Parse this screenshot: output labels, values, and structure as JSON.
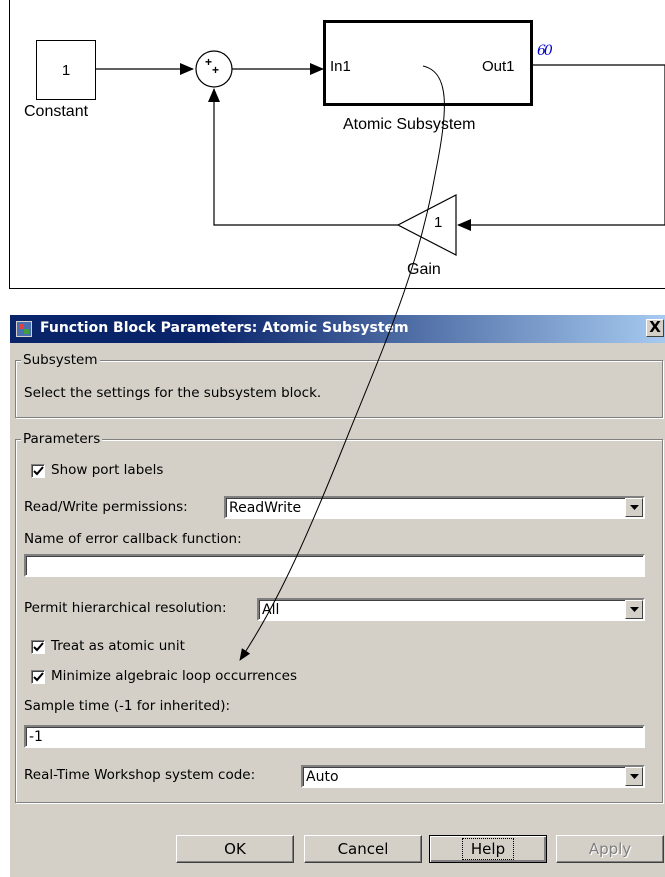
{
  "model": {
    "constant_value": "1",
    "constant_label": "Constant",
    "sum_signs": [
      "+",
      "+"
    ],
    "subsystem_in": "In1",
    "subsystem_out": "Out1",
    "subsystem_label": "Atomic Subsystem",
    "gain_value": "1",
    "gain_label": "Gain",
    "signal_viewer_glyph": "60"
  },
  "dialog": {
    "title": "Function Block Parameters: Atomic Subsystem",
    "close_label": "X",
    "subsystem_group_title": "Subsystem",
    "description": "Select the settings for the subsystem block.",
    "parameters_group_title": "Parameters",
    "show_port_labels": {
      "label": "Show port labels",
      "checked": true
    },
    "rw_permissions": {
      "label": "Read/Write permissions:",
      "value": "ReadWrite"
    },
    "error_callback": {
      "label": "Name of error callback function:",
      "value": ""
    },
    "hier_resolution": {
      "label": "Permit hierarchical resolution:",
      "value": "All"
    },
    "treat_atomic": {
      "label": "Treat as atomic unit",
      "checked": true
    },
    "minimize_loops": {
      "label": "Minimize algebraic loop occurrences",
      "checked": true
    },
    "sample_time": {
      "label": "Sample time (-1 for inherited):",
      "value": "-1"
    },
    "rtw_code": {
      "label": "Real-Time Workshop system code:",
      "value": "Auto"
    },
    "buttons": {
      "ok": "OK",
      "cancel": "Cancel",
      "help": "Help",
      "apply": "Apply"
    }
  },
  "colors": {
    "titlebar": "#0a246a",
    "dialog_bg": "#d4d0c8",
    "viewer_glyph": "#0000cc"
  }
}
